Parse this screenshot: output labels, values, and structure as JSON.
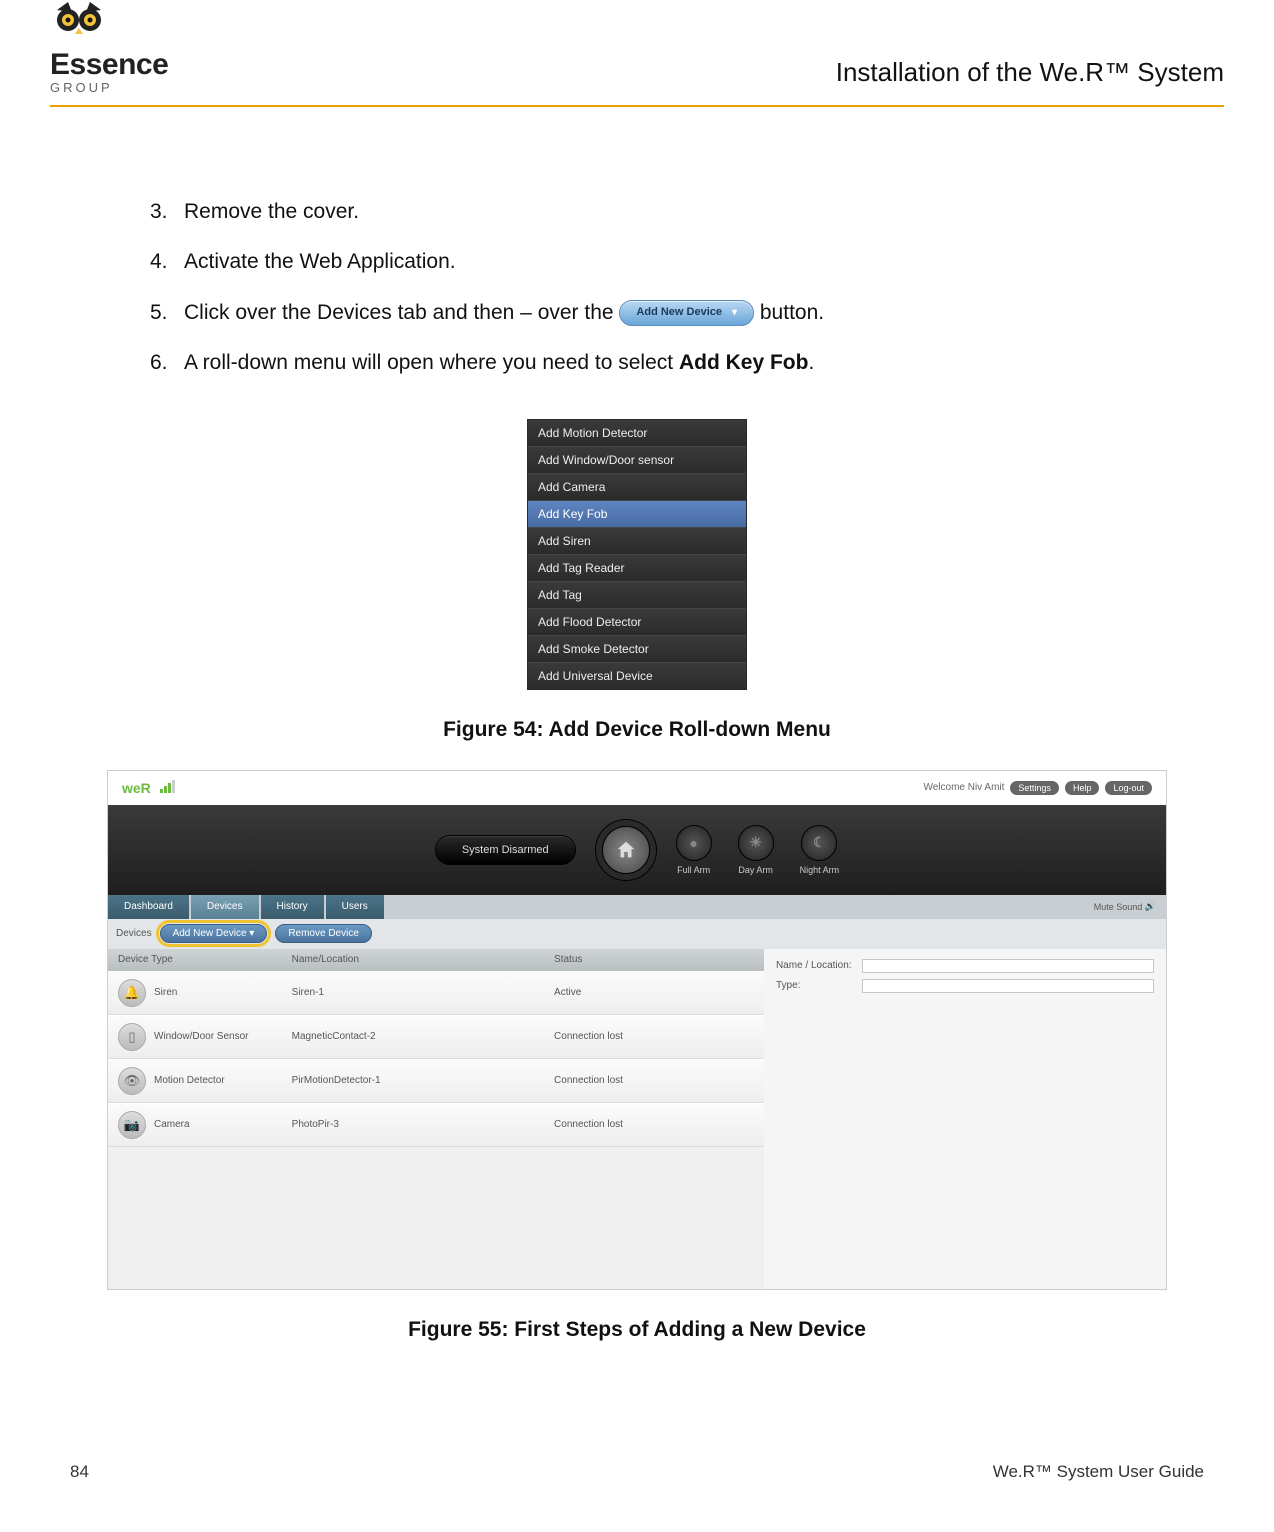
{
  "header": {
    "brand_main": "Essence",
    "brand_sub": "GROUP",
    "chapter_title": "Installation of the We.R™ System"
  },
  "steps": [
    {
      "num": "3.",
      "text": "Remove the cover."
    },
    {
      "num": "4.",
      "text": "Activate the Web Application."
    },
    {
      "num": "5.",
      "pre": "Click over the Devices tab and then – over the ",
      "button_label": "Add New Device",
      "post": " button."
    },
    {
      "num": "6.",
      "pre": "A roll-down menu will open where you need to select ",
      "bold": "Add Key Fob",
      "post": "."
    }
  ],
  "dropdown_menu": {
    "items": [
      "Add Motion Detector",
      "Add Window/Door sensor",
      "Add Camera",
      "Add Key Fob",
      "Add Siren",
      "Add Tag Reader",
      "Add Tag",
      "Add Flood Detector",
      "Add Smoke Detector",
      "Add Universal Device"
    ],
    "selected_index": 3
  },
  "fig54_caption": "Figure 54: Add Device Roll-down Menu",
  "fig55": {
    "brand": "weR",
    "welcome": "Welcome Niv Amit",
    "top_links": [
      "Settings",
      "Help",
      "Log-out"
    ],
    "system_status": "System Disarmed",
    "arm_buttons": [
      "Full Arm",
      "Day Arm",
      "Night Arm"
    ],
    "mute_label": "Mute Sound",
    "nav_tabs": [
      "Dashboard",
      "Devices",
      "History",
      "Users"
    ],
    "sub_bar": {
      "devices_label": "Devices",
      "add_label": "Add New Device",
      "remove_label": "Remove Device"
    },
    "list_headers": [
      "Device Type",
      "Name/Location",
      "Status"
    ],
    "rows": [
      {
        "type": "Siren",
        "name": "Siren-1",
        "status": "Active"
      },
      {
        "type": "Window/Door Sensor",
        "name": "MagneticContact-2",
        "status": "Connection lost"
      },
      {
        "type": "Motion Detector",
        "name": "PirMotionDetector-1",
        "status": "Connection lost"
      },
      {
        "type": "Camera",
        "name": "PhotoPir-3",
        "status": "Connection lost"
      }
    ],
    "side_panel": {
      "name_label": "Name / Location:",
      "type_label": "Type:"
    }
  },
  "fig55_caption": "Figure 55: First Steps of Adding a New Device",
  "footer": {
    "page": "84",
    "guide": "We.R™ System User Guide"
  }
}
